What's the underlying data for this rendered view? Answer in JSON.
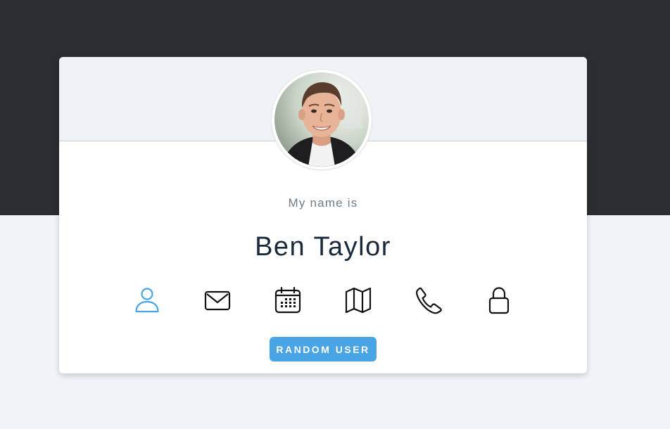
{
  "card": {
    "label": "My name is",
    "name": "Ben Taylor"
  },
  "icons": [
    {
      "name": "user-icon",
      "active": true
    },
    {
      "name": "envelope-icon",
      "active": false
    },
    {
      "name": "calendar-icon",
      "active": false
    },
    {
      "name": "map-icon",
      "active": false
    },
    {
      "name": "phone-icon",
      "active": false
    },
    {
      "name": "lock-icon",
      "active": false
    }
  ],
  "button": {
    "label": "RANDOM USER"
  },
  "colors": {
    "top_band": "#2b2d31",
    "page_background": "#f0f4f8",
    "accent": "#49a4e6",
    "name_text": "#1b2a3a",
    "label_text": "#6a7c8f"
  }
}
